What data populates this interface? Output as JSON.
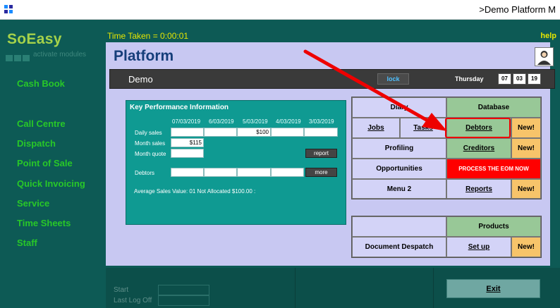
{
  "window": {
    "title": ">Demo Platform M"
  },
  "sidebar": {
    "logo": "SoEasy",
    "activate": "activate modules",
    "items": [
      {
        "label": "Cash Book"
      },
      {
        "label": "Call Centre"
      },
      {
        "label": "Dispatch"
      },
      {
        "label": "Point of Sale"
      },
      {
        "label": "Quick Invoicing"
      },
      {
        "label": "Service"
      },
      {
        "label": "Time Sheets"
      },
      {
        "label": "Staff"
      }
    ]
  },
  "status": {
    "time_taken": "Time Taken = 0:00:01",
    "help": "help"
  },
  "main": {
    "title": "Platform",
    "company": "Demo",
    "lock": "lock",
    "day": "Thursday",
    "date": [
      "07",
      "03",
      "19"
    ]
  },
  "kpi": {
    "title": "Key Performance Information",
    "dates": [
      "07/03/2019",
      "6/03/2019",
      "5/03/2019",
      "4/03/2019",
      "3/03/2019"
    ],
    "labels": {
      "daily": "Daily sales",
      "month_sales": "Month sales",
      "month_quote": "Month quote",
      "debtors": "Debtors"
    },
    "daily_values": [
      "",
      "",
      "$100",
      "",
      ""
    ],
    "month_sales": "$115",
    "month_quote": "",
    "debtor_values": [
      "",
      "",
      "",
      ""
    ],
    "report": "report",
    "more": "more",
    "average": "Average Sales Value: 01 Not Allocated $100.00 :"
  },
  "menu": {
    "diary": "Diary",
    "database": "Database",
    "jobs": "Jobs",
    "tasks": "Tasks",
    "debtors": "Debtors",
    "new": "New!",
    "profiling": "Profiling",
    "creditors": "Creditors",
    "opportunities": "Opportunities",
    "process_eom": "PROCESS THE EOM NOW",
    "menu2": "Menu 2",
    "reports": "Reports",
    "products": "Products",
    "document_despatch": "Document Despatch",
    "setup": "Set up"
  },
  "bottom": {
    "start": "Start",
    "last_log_off": "Last Log Off",
    "exit": "Exit"
  },
  "colors": {
    "background": "#0d5a55",
    "panel": "#c8c8f2",
    "nav_text": "#28c828",
    "accent_green": "#98c897",
    "accent_orange": "#f7c46a",
    "alert_red": "#ff0000"
  }
}
